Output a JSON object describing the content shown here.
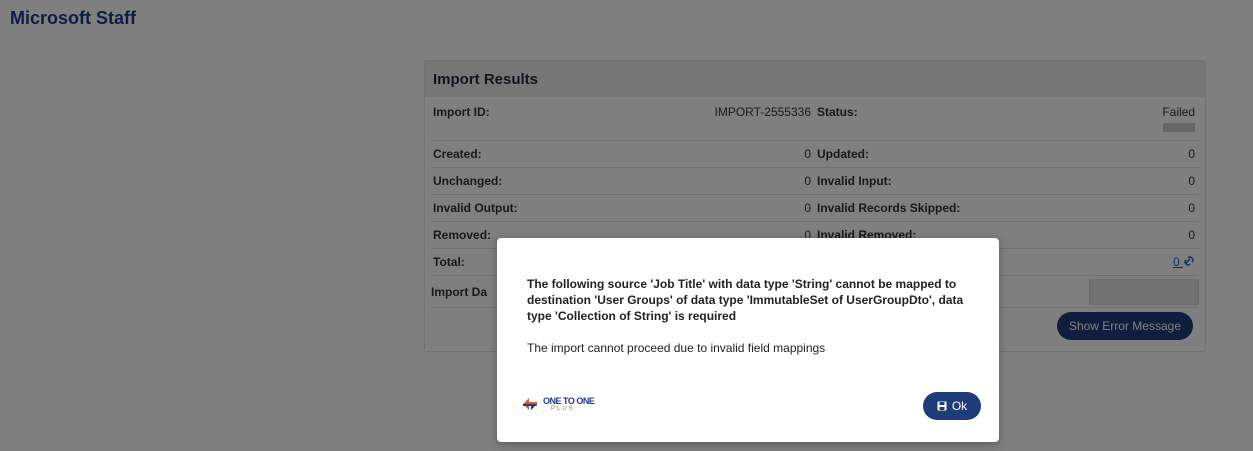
{
  "app": {
    "title": "Microsoft Staff"
  },
  "panel": {
    "title": "Import Results",
    "rows": [
      {
        "left_label": "Import ID:",
        "left_value": "IMPORT-2555336",
        "right_label": "Status:",
        "right_value": "Failed"
      },
      {
        "left_label": "Created:",
        "left_value": "0",
        "right_label": "Updated:",
        "right_value": "0"
      },
      {
        "left_label": "Unchanged:",
        "left_value": "0",
        "right_label": "Invalid Input:",
        "right_value": "0"
      },
      {
        "left_label": "Invalid Output:",
        "left_value": "0",
        "right_label": "Invalid Records Skipped:",
        "right_value": "0"
      },
      {
        "left_label": "Removed:",
        "left_value": "0",
        "right_label": "Invalid Removed:",
        "right_value": "0"
      },
      {
        "left_label": "Total:",
        "left_value": "",
        "right_label": "",
        "right_value": "0"
      }
    ],
    "import_date_label": "Import Da",
    "show_error_label": "Show Error Message"
  },
  "modal": {
    "message": "The following source 'Job Title' with data type 'String' cannot be mapped to destination 'User Groups' of data type 'ImmutableSet of UserGroupDto', data type 'Collection of String' is required",
    "sub_message": "The import cannot proceed due to invalid field mappings",
    "ok_label": "Ok",
    "logo_text": "ONE TO ONE",
    "logo_sub": "PLUS"
  },
  "icons": {
    "link": "link-icon",
    "save": "save-icon",
    "logo": "logo-icon"
  }
}
